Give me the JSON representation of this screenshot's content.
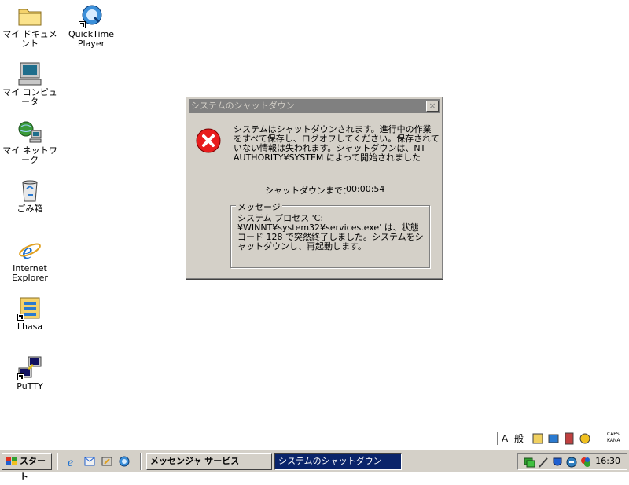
{
  "desktop": {
    "icons": [
      {
        "label": "マイ ドキュメント"
      },
      {
        "label": "QuickTime Player"
      },
      {
        "label": "マイ コンピュータ"
      },
      {
        "label": "マイ ネットワーク"
      },
      {
        "label": "ごみ箱"
      },
      {
        "label": "Internet Explorer"
      },
      {
        "label": "Lhasa"
      },
      {
        "label": "PuTTY"
      }
    ]
  },
  "dialog": {
    "title": "システムのシャットダウン",
    "close_glyph": "×",
    "message": "システムはシャットダウンされます。進行中の作業をすべて保存し、ログオフしてください。保存されていない情報は失われます。シャットダウンは、NT AUTHORITY¥SYSTEM によって開始されました",
    "countdown_label": "シャットダウンまで：",
    "countdown_value": "00:00:54",
    "group_label": "メッセージ",
    "group_text": "システム プロセス 'C:¥WINNT¥system32¥services.exe' は、状態コード 128 で突然終了しました。システムをシャットダウンし、再起動します。"
  },
  "langbar": {
    "mode_a": "A",
    "mode_kanji": "般",
    "caps": "CAPS",
    "kana": "KANA"
  },
  "taskbar": {
    "start_label": "スタート",
    "tasks": [
      {
        "label": "メッセンジャ サービス",
        "active": false
      },
      {
        "label": "システムのシャットダウン",
        "active": true
      }
    ],
    "clock": "16:30"
  },
  "colors": {
    "desktop": "#ffffff",
    "face": "#d4d0c8",
    "titlebar_inactive": "#808080",
    "active_task": "#0a246a",
    "error_red": "#e81c1c"
  }
}
